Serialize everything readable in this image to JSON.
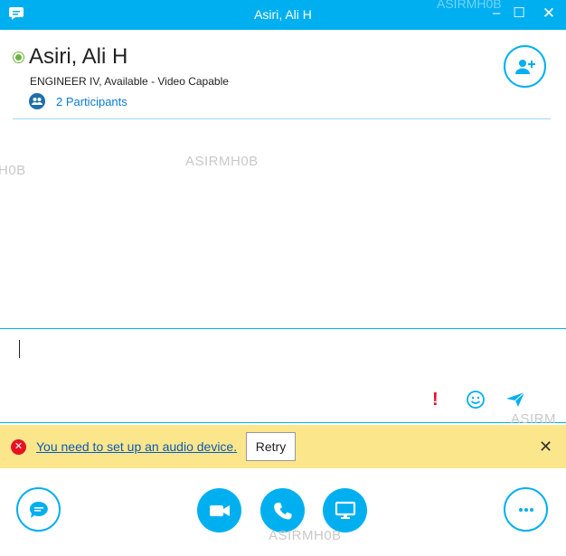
{
  "window": {
    "title": "Asiri, Ali H",
    "watermark": "ASIRMH0B",
    "controls": {
      "minimize": "‒",
      "maximize": "☐",
      "close": "✕"
    }
  },
  "contact": {
    "name": "Asiri, Ali H",
    "role": "ENGINEER IV",
    "presence": "Available",
    "capability": "Video Capable",
    "subtitle": "ENGINEER IV,  Available - Video Capable",
    "participants_label": "2 Participants",
    "status_color": "#6cb33f"
  },
  "conversation": {
    "watermarks": [
      "H0B",
      "ASIRMH0B"
    ]
  },
  "compose": {
    "value": "",
    "priority_label": "!",
    "icons": [
      "priority-icon",
      "emoticon-icon",
      "send-icon"
    ]
  },
  "notification": {
    "message": "You need to set up an audio device.",
    "retry_label": "Retry",
    "dismiss_label": "✕",
    "watermark": "ASIRM"
  },
  "toolbar": {
    "buttons": [
      "im-button",
      "video-button",
      "call-button",
      "present-button",
      "more-options-button"
    ],
    "watermark": "ASIRMH0B"
  },
  "colors": {
    "accent": "#00aff0",
    "notice_bg": "#fce68c",
    "error": "#e81123",
    "link": "#0a5bb5"
  }
}
